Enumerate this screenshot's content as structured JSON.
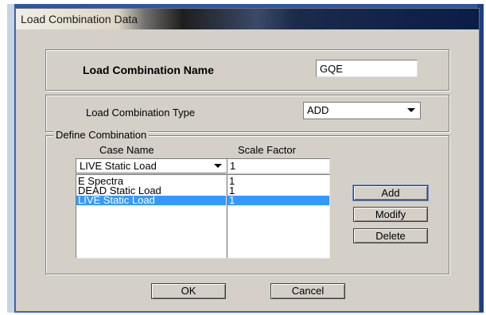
{
  "title": "Load Combination Data",
  "name_section": {
    "label": "Load Combination Name",
    "value": "GQE"
  },
  "type_section": {
    "label": "Load Combination Type",
    "selected": "ADD"
  },
  "define": {
    "legend": "Define Combination",
    "case_header": "Case Name",
    "scale_header": "Scale Factor",
    "case_selected": "LIVE Static Load",
    "scale_value": "1",
    "rows": [
      {
        "case": "E Spectra",
        "scale": "1"
      },
      {
        "case": "DEAD Static Load",
        "scale": "1"
      },
      {
        "case": "LIVE Static Load",
        "scale": "1"
      }
    ],
    "add": "Add",
    "modify": "Modify",
    "delete": "Delete"
  },
  "ok": "OK",
  "cancel": "Cancel"
}
